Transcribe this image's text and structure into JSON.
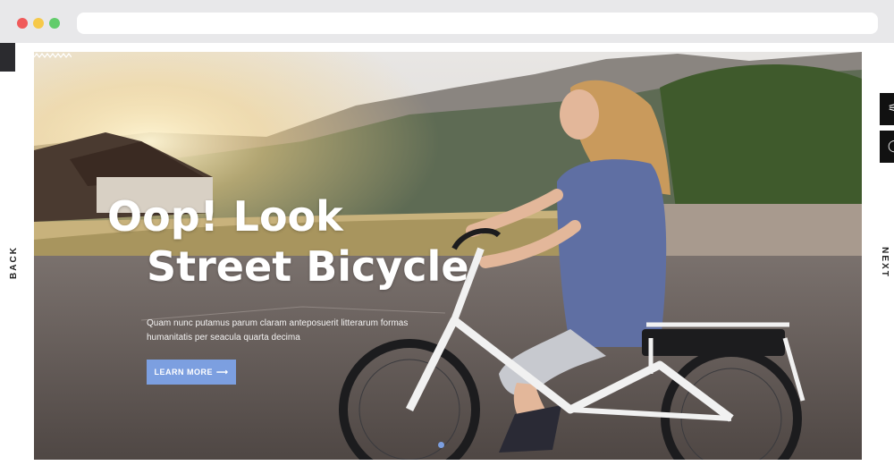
{
  "hero": {
    "headline_line1": "Oop! Look",
    "headline_line2": "Street Bicycle",
    "description": "Quam nunc putamus parum claram anteposuerit litterarum formas humanitatis per seacula quarta decima",
    "cta_label": "LEARN MORE",
    "cta_arrow": "⟶"
  },
  "navigation": {
    "back_label": "BACK",
    "next_label": "NEXT"
  },
  "colors": {
    "accent": "#7c9fe0",
    "dark": "#111111"
  },
  "icons": [
    "close-icon",
    "minimize-icon",
    "maximize-icon",
    "arrow-right-icon",
    "menu-icon",
    "search-icon"
  ]
}
